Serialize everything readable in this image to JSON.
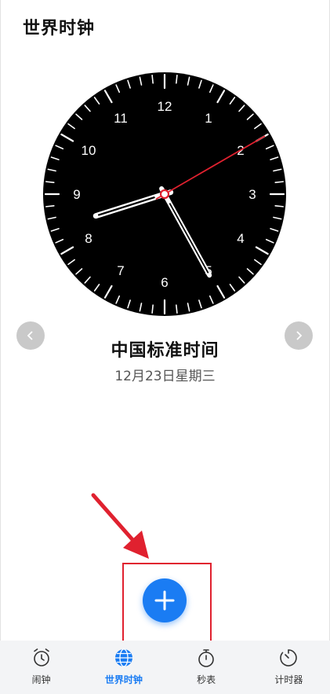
{
  "header": {
    "title": "世界时钟"
  },
  "clock": {
    "numbers": [
      "12",
      "1",
      "2",
      "3",
      "4",
      "5",
      "6",
      "7",
      "8",
      "9",
      "10",
      "11"
    ],
    "time": {
      "hour": 8,
      "minute": 25,
      "second": 10
    },
    "face_color": "#000000",
    "second_hand_color": "#e0212f"
  },
  "timezone": {
    "name": "中国标准时间",
    "date": "12月23日星期三"
  },
  "fab": {
    "icon": "plus-icon",
    "color": "#1a7cf3"
  },
  "annotation": {
    "color": "#e0212f"
  },
  "tabs": [
    {
      "label": "闹钟",
      "icon": "alarm-clock-icon",
      "active": false
    },
    {
      "label": "世界时钟",
      "icon": "globe-icon",
      "active": true
    },
    {
      "label": "秒表",
      "icon": "stopwatch-icon",
      "active": false
    },
    {
      "label": "计时器",
      "icon": "timer-icon",
      "active": false
    }
  ],
  "accent_color": "#1a7cf3"
}
